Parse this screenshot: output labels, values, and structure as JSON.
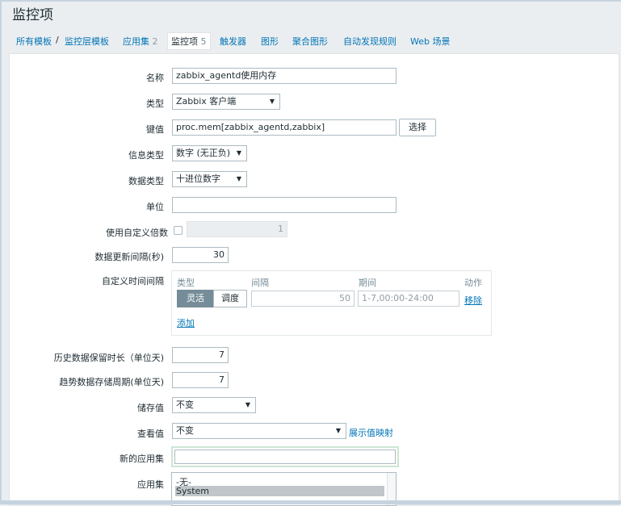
{
  "page_title": "监控项",
  "tabs": [
    {
      "label": "所有模板",
      "count": ""
    },
    {
      "label": "监控层模板",
      "count": ""
    },
    {
      "label": "应用集",
      "count": "2"
    },
    {
      "label": "监控项",
      "count": "5"
    },
    {
      "label": "触发器",
      "count": ""
    },
    {
      "label": "图形",
      "count": ""
    },
    {
      "label": "聚合图形",
      "count": ""
    },
    {
      "label": "自动发现规则",
      "count": ""
    },
    {
      "label": "Web 场景",
      "count": ""
    }
  ],
  "breadcrumb_separator": "/",
  "form": {
    "name": {
      "label": "名称",
      "value": "zabbix_agentd使用内存"
    },
    "type": {
      "label": "类型",
      "value": "Zabbix 客户端"
    },
    "key": {
      "label": "键值",
      "value": "proc.mem[zabbix_agentd,zabbix]",
      "button": "选择"
    },
    "info_type": {
      "label": "信息类型",
      "value": "数字 (无正负)"
    },
    "data_type": {
      "label": "数据类型",
      "value": "十进位数字"
    },
    "units": {
      "label": "单位",
      "value": ""
    },
    "multiplier": {
      "label": "使用自定义倍数",
      "value": "1",
      "checked": false
    },
    "update_interval": {
      "label": "数据更新间隔(秒)",
      "value": "30"
    },
    "custom_intervals": {
      "label": "自定义时间间隔",
      "headers": {
        "type": "类型",
        "interval": "间隔",
        "period": "期间",
        "action": "动作"
      },
      "row": {
        "flexible": "灵活",
        "scheduling": "调度",
        "interval": "50",
        "period": "1-7,00:00-24:00",
        "remove": "移除"
      },
      "add": "添加"
    },
    "history": {
      "label": "历史数据保留时长（单位天)",
      "value": "7"
    },
    "trends": {
      "label": "趋势数据存储周期(单位天)",
      "value": "7"
    },
    "store_value": {
      "label": "储存值",
      "value": "不变"
    },
    "show_value": {
      "label": "查看值",
      "value": "不变",
      "link": "展示值映射"
    },
    "new_application": {
      "label": "新的应用集",
      "value": ""
    },
    "applications": {
      "label": "应用集",
      "options": [
        "-无-",
        "System"
      ],
      "selected": "System"
    }
  }
}
